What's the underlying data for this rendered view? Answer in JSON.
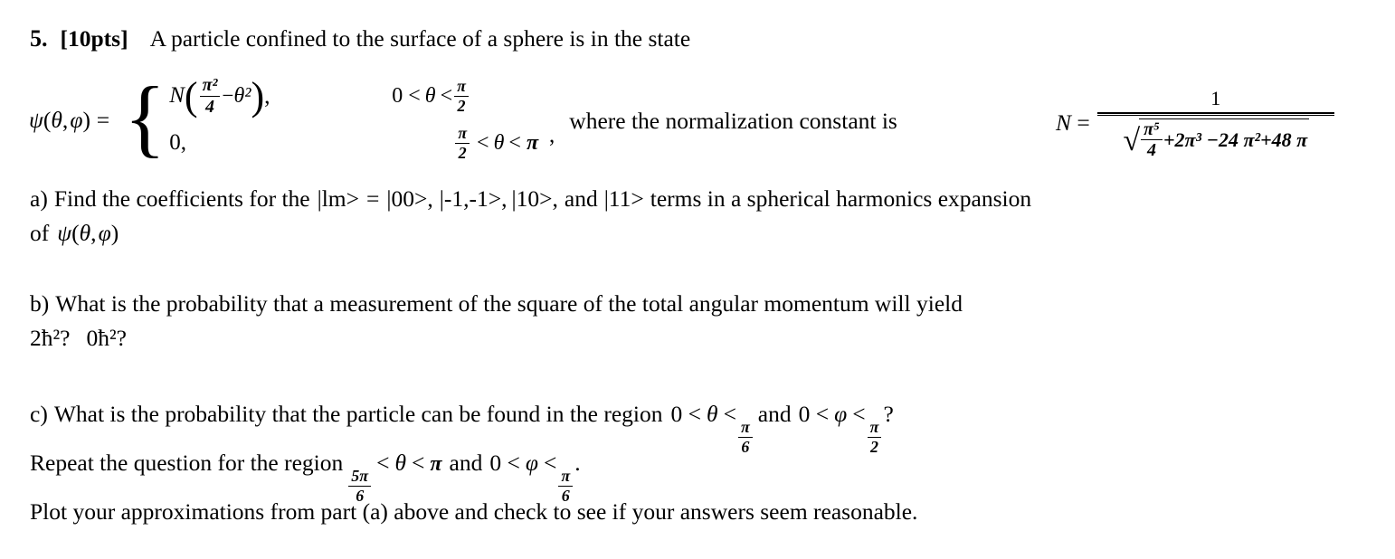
{
  "document": {
    "background_color": "#ffffff",
    "text_color": "#000000",
    "problem_number": "5.",
    "points_label": "[10pts]"
  },
  "line1": {
    "number": "5.",
    "points": "[10pts]",
    "statement": "A particle confined to the surface of a sphere is in the state"
  },
  "equation": {
    "lhs": "ψ(θ, φ)  =",
    "psi_symbol": "ψ",
    "theta_symbol": "θ",
    "phi_symbol": "φ",
    "equals": "=",
    "case1": {
      "value_prefix": "N",
      "inner_fraction_num": "π²",
      "inner_fraction_den": "4",
      "inner_minus": "−",
      "inner_term": "θ²",
      "trailing_comma": ",",
      "condition_left": "0 <",
      "condition_var": "θ",
      "condition_rel": "<",
      "condition_num": "π",
      "condition_den": "2"
    },
    "case2": {
      "value": "0,",
      "condition_num": "π",
      "condition_den": "2",
      "condition_rel_left": "<",
      "condition_var": "θ",
      "condition_rel_right": "<",
      "condition_right": "π"
    },
    "separator_comma": ",",
    "where_text": "where the normalization constant is",
    "N_symbol": "N",
    "N_equals": "=",
    "N_numerator": "1",
    "N_denominator": {
      "sqrt_glyph": "√",
      "frac_num": "π⁵",
      "frac_den": "4",
      "rest": "+2π³ −24 π²+48 π"
    }
  },
  "part_a": {
    "label": "a)",
    "text_before_kets": "Find the coefficients for the",
    "ket_lm": "|lm>",
    "equals": "=",
    "ket_00": "|00>,",
    "ket_m1m1": "|-1,-1>,",
    "ket_10": "|10>,",
    "and_word": "and",
    "ket_11": "|11>",
    "text_after_kets": "terms in a spherical harmonics expansion",
    "line2_prefix": "of",
    "line2_psi": "ψ(θ, φ)"
  },
  "part_b": {
    "label": "b)",
    "line1": "What is the probability that a measurement of the square of the total angular momentum will yield",
    "line2_first": "2ħ²?",
    "line2_second": "0ħ²?"
  },
  "part_c": {
    "label": "c)",
    "line1_text": "What is the probability that the particle can be found in the region",
    "line1_ineq1_left": "0 <",
    "line1_theta": "θ",
    "line1_rel": "<",
    "line1_frac1_num": "π",
    "line1_frac1_den": "6",
    "line1_and": "and",
    "line1_ineq2_left": "0 <",
    "line1_phi": "φ",
    "line1_rel2": "<",
    "line1_frac2_num": "π",
    "line1_frac2_den": "2",
    "line1_question_mark": "?",
    "line2_text": "Repeat the question for the region",
    "line2_frac1_num": "5π",
    "line2_frac1_den": "6",
    "line2_rel1": "<",
    "line2_theta": "θ",
    "line2_rel2": "<",
    "line2_pi": "π",
    "line2_and": "and",
    "line2_ineq_left": "0 <",
    "line2_phi": "φ",
    "line2_rel3": "<",
    "line2_frac2_num": "π",
    "line2_frac2_den": "6",
    "line2_period": ".",
    "line3": "Plot your approximations from part (a) above and check to see if your answers seem reasonable."
  }
}
